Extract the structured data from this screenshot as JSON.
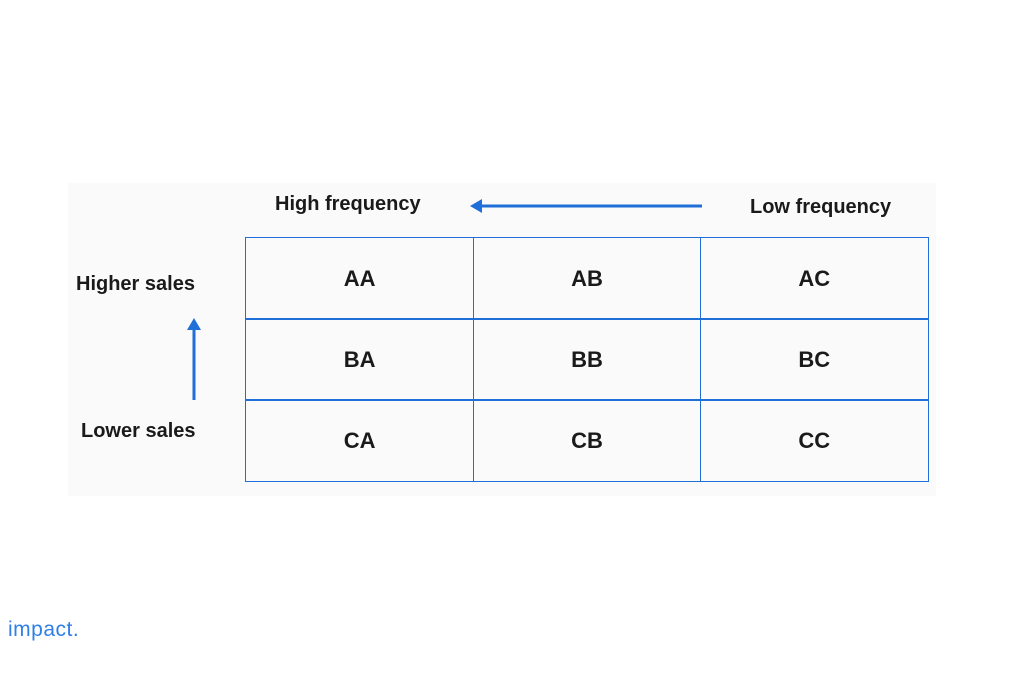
{
  "diagram": {
    "x_axis": {
      "left_label": "High frequency",
      "right_label": "Low frequency",
      "arrow_direction": "left"
    },
    "y_axis": {
      "top_label": "Higher sales",
      "bottom_label": "Lower sales",
      "arrow_direction": "up"
    },
    "cells": [
      [
        "AA",
        "AB",
        "AC"
      ],
      [
        "BA",
        "BB",
        "BC"
      ],
      [
        "CA",
        "CB",
        "CC"
      ]
    ],
    "accent_color": "#1f6fd8"
  },
  "brand": {
    "logo_text": "impact."
  }
}
